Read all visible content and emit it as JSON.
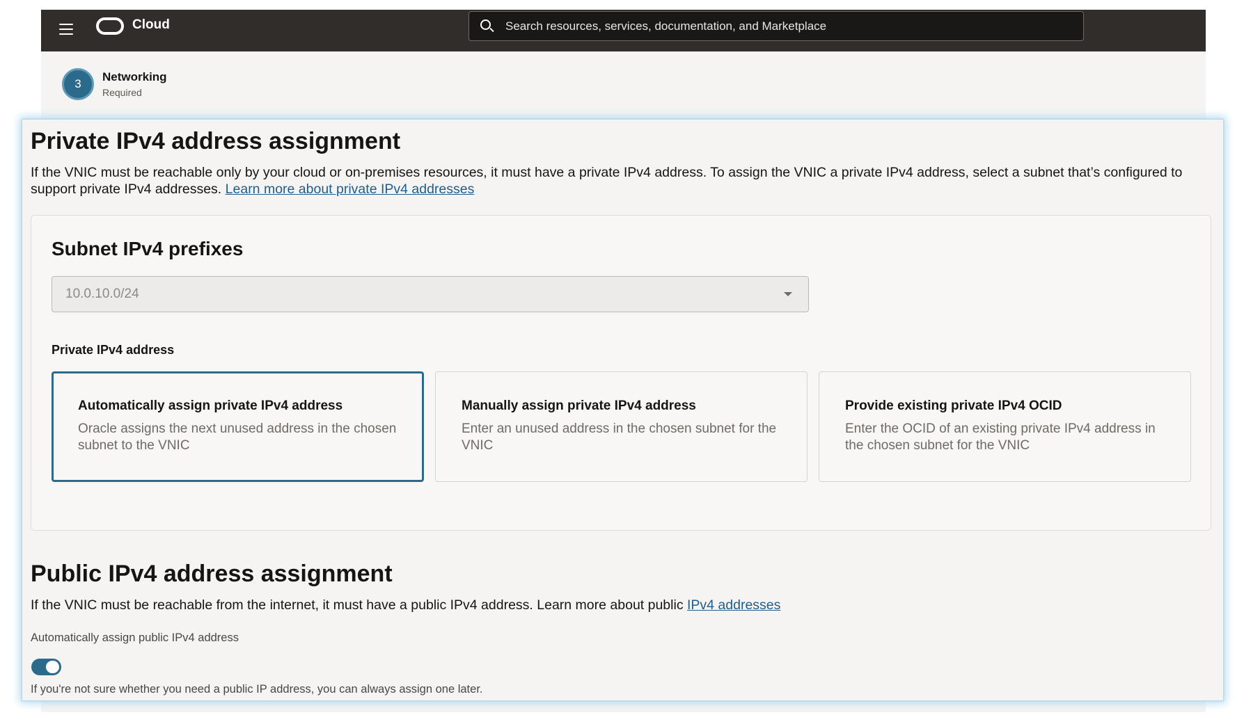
{
  "header": {
    "app_name": "Cloud",
    "search_placeholder": "Search resources, services, documentation, and Marketplace"
  },
  "step": {
    "number": "3",
    "title": "Networking",
    "subtitle": "Required"
  },
  "private_section": {
    "title": "Private IPv4 address assignment",
    "description": "If the VNIC must be reachable only by your cloud or on-premises resources, it must have a private IPv4 address. To assign the VNIC a private IPv4 address, select a subnet that’s configured to support private IPv4 addresses.",
    "learn_more_link": "Learn more about private IPv4 addresses",
    "subnet_title": "Subnet IPv4 prefixes",
    "subnet_value": "10.0.10.0/24",
    "address_label": "Private IPv4 address",
    "options": [
      {
        "title": "Automatically assign private IPv4 address",
        "description": "Oracle assigns the next unused address in the chosen subnet to the VNIC",
        "selected": true
      },
      {
        "title": "Manually assign private IPv4 address",
        "description": "Enter an unused address in the chosen subnet for the VNIC",
        "selected": false
      },
      {
        "title": "Provide existing private IPv4 OCID",
        "description": "Enter the OCID of an existing private IPv4 address in the chosen subnet for the VNIC",
        "selected": false
      }
    ]
  },
  "public_section": {
    "title": "Public IPv4 address assignment",
    "description": "If the VNIC must be reachable from the internet, it must have a public IPv4 address. Learn more about public",
    "link": "IPv4 addresses",
    "toggle_label": "Automatically assign public IPv4 address",
    "toggle_on": true,
    "hint": "If you're not sure whether you need a public IP address, you can always assign one later."
  },
  "colors": {
    "accent": "#2c6a8b",
    "topbar": "#312d2a",
    "link": "#1f5e8c",
    "focus_glow": "#b9dcef"
  }
}
